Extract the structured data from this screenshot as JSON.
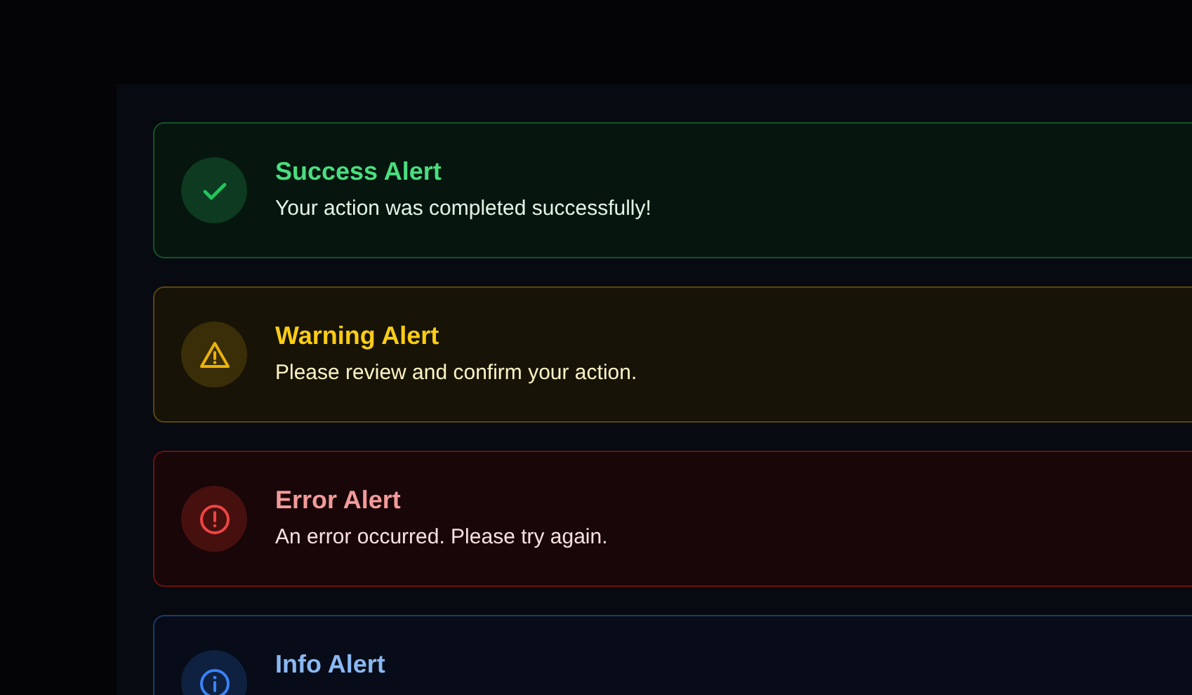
{
  "alerts": [
    {
      "kind": "success",
      "title": "Success Alert",
      "message": "Your action was completed successfully!"
    },
    {
      "kind": "warning",
      "title": "Warning Alert",
      "message": "Please review and confirm your action."
    },
    {
      "kind": "error",
      "title": "Error Alert",
      "message": "An error occurred. Please try again."
    },
    {
      "kind": "info",
      "title": "Info Alert"
    }
  ]
}
